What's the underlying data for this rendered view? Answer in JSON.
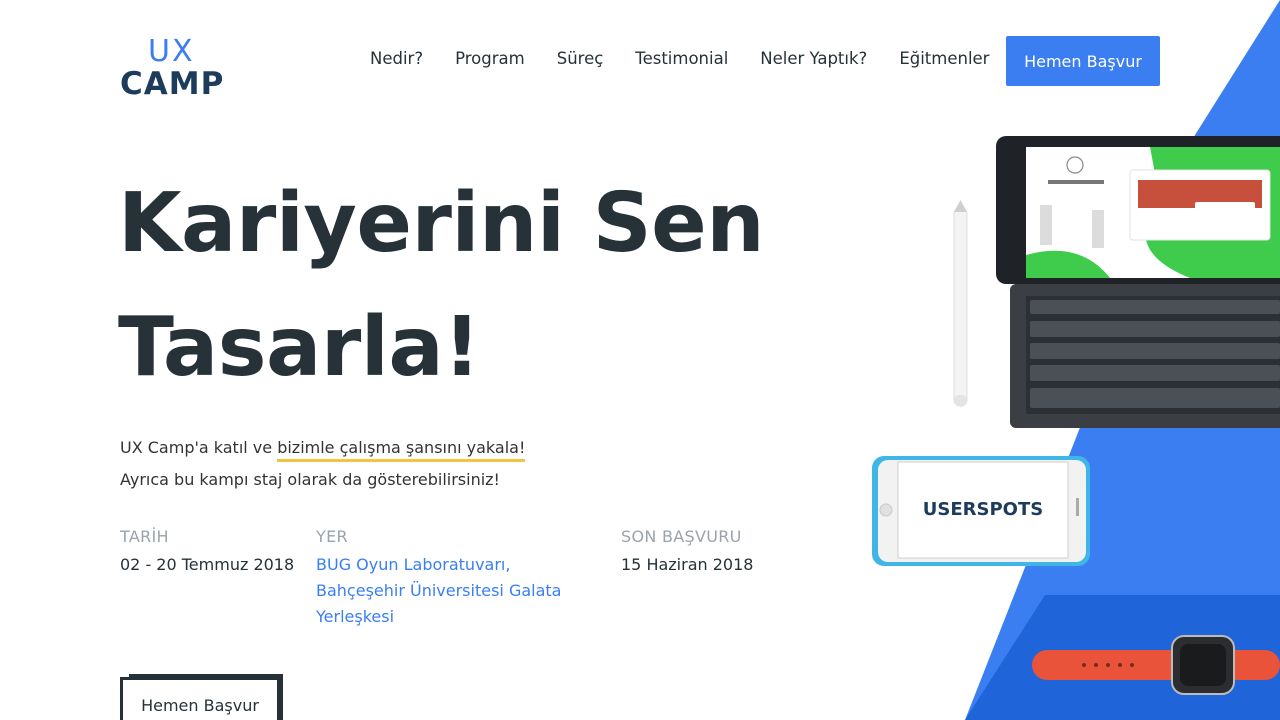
{
  "logo": {
    "line1": "UX",
    "line2": "CAMP"
  },
  "nav": {
    "items": [
      "Nedir?",
      "Program",
      "Süreç",
      "Testimonial",
      "Neler Yaptık?",
      "Eğitmenler"
    ],
    "cta_label": "Hemen Başvur"
  },
  "hero": {
    "title_line1": "Kariyerini Sen",
    "title_line2": "Tasarla!",
    "lead_prefix": "UX Camp'a katıl ve ",
    "lead_highlight": "bizimle çalışma şansını yakala!",
    "lead_line2": "Ayrıca bu kampı staj olarak da gösterebilirsiniz!"
  },
  "info": {
    "date": {
      "label": "TARİH",
      "value": "02 - 20 Temmuz 2018"
    },
    "place": {
      "label": "YER",
      "line1": "BUG Oyun Laboratuvarı,",
      "line2": "Bahçeşehir Üniversitesi Galata",
      "line3": "Yerleşkesi"
    },
    "deadline": {
      "label": "SON BAŞVURU",
      "value": "15 Haziran 2018"
    }
  },
  "cta_bottom_label": "Hemen Başvur",
  "phone_brand": "USERSPOTS",
  "colors": {
    "accent": "#3a7ef2",
    "highlight": "#f4c341",
    "text": "#263238",
    "muted": "#9aa3ab"
  }
}
